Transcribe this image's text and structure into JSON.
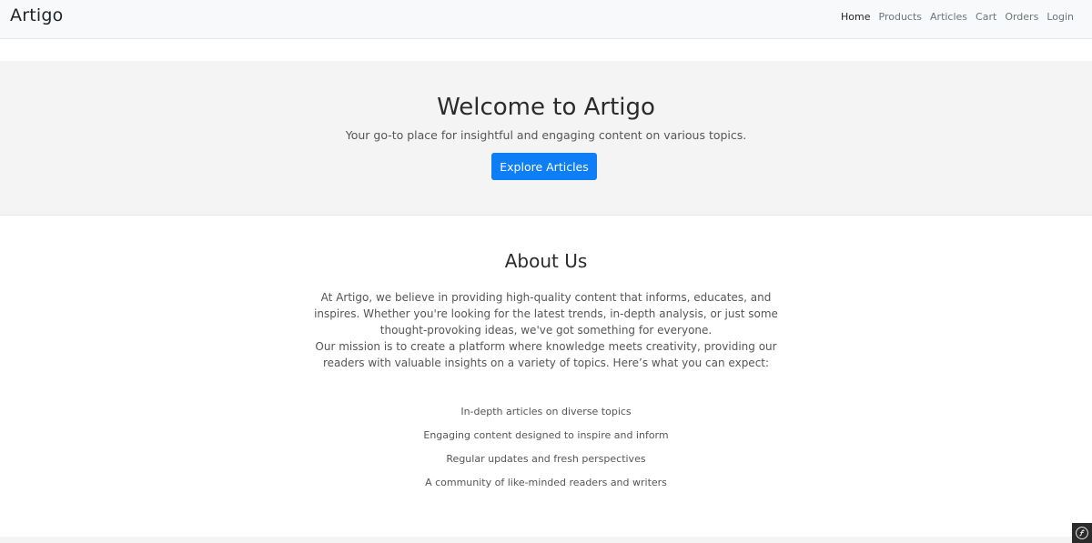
{
  "navbar": {
    "brand": "Artigo",
    "links": [
      {
        "label": "Home"
      },
      {
        "label": "Products"
      },
      {
        "label": "Articles"
      },
      {
        "label": "Cart"
      },
      {
        "label": "Orders"
      },
      {
        "label": "Login"
      }
    ]
  },
  "hero": {
    "title": "Welcome to Artigo",
    "subtitle": "Your go-to place for insightful and engaging content on various topics.",
    "button_label": "Explore Articles",
    "button_color": "#0d7ef5"
  },
  "about": {
    "title": "About Us",
    "paragraph1": "At Artigo, we believe in providing high-quality content that informs, educates, and inspires. Whether you're looking for the latest trends, in-depth analysis, or just some thought-provoking ideas, we've got something for everyone.",
    "paragraph2": "Our mission is to create a platform where knowledge meets creativity, providing our readers with valuable insights on a variety of topics. Here’s what you can expect:",
    "features": [
      "In-depth articles on diverse topics",
      "Engaging content designed to inspire and inform",
      "Regular updates and fresh perspectives",
      "A community of like-minded readers and writers"
    ]
  },
  "toolbar": {
    "icon": "symfony-icon"
  }
}
